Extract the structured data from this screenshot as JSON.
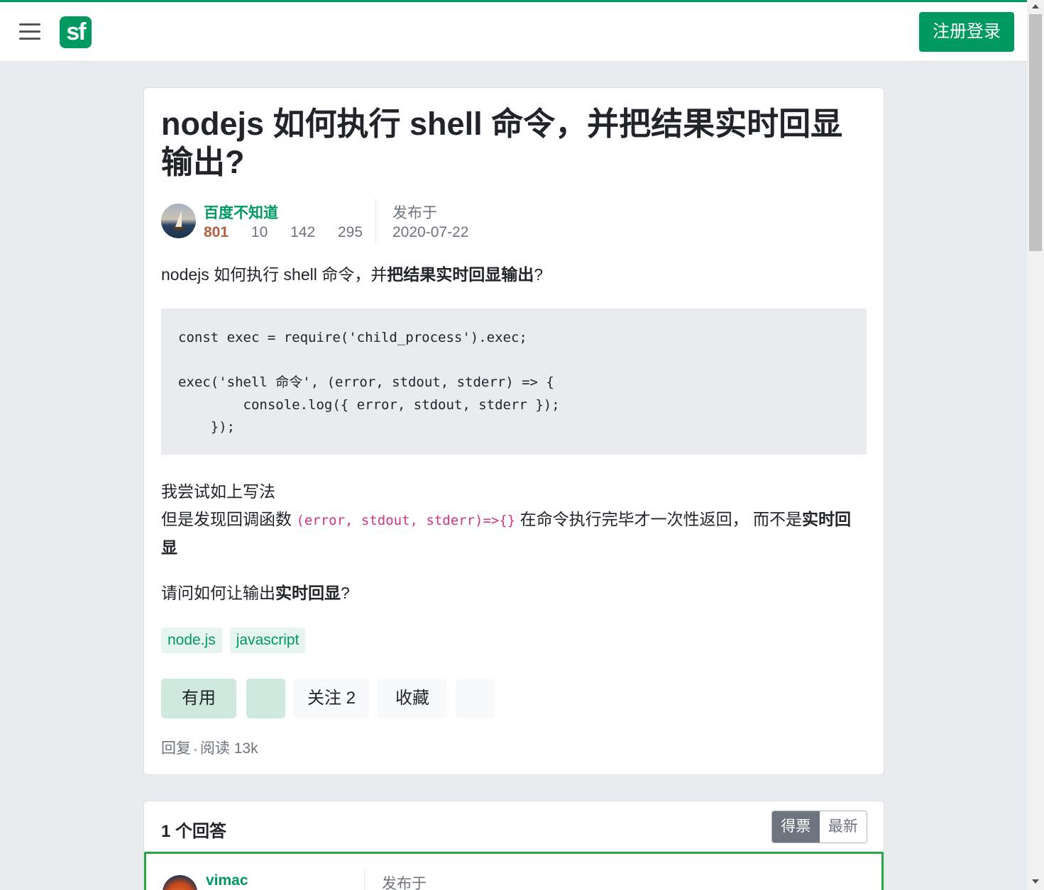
{
  "navbar": {
    "logo_text": "sf",
    "login_label": "注册登录"
  },
  "question": {
    "title": "nodejs 如何执行 shell 命令，并把结果实时回显输出?",
    "author": {
      "name": "百度不知道",
      "reputation": "801",
      "stat1": "10",
      "stat2": "142",
      "stat3": "295"
    },
    "published_label": "发布于",
    "published_date": "2020-07-22",
    "body": {
      "p1_plain": "nodejs 如何执行 shell 命令，并",
      "p1_bold": "把结果实时回显输出",
      "p1_end": "?",
      "code": "const exec = require('child_process').exec;\n\nexec('shell 命令', (error, stdout, stderr) => {\n        console.log({ error, stdout, stderr });\n    });",
      "p2_line1": "我尝试如上写法",
      "p2_line2_start": "但是发现回调函数 ",
      "p2_inline_code": "(error, stdout, stderr)=>{}",
      "p2_line2_mid": " 在命令执行完毕才一次性返回， 而不是",
      "p2_bold": "实时回显",
      "p3_plain": "请问如何让输出",
      "p3_bold": "实时回显",
      "p3_end": "?"
    },
    "tags": [
      "node.js",
      "javascript"
    ],
    "actions": {
      "useful": "有用",
      "follow": "关注 2",
      "favorite": "收藏"
    },
    "meta": {
      "reply": "回复",
      "separator": "•",
      "reads": "阅读 13k"
    }
  },
  "answers": {
    "title": "1 个回答",
    "sort_votes": "得票",
    "sort_latest": "最新",
    "first": {
      "author": "vimac",
      "published_label": "发布于"
    }
  },
  "colors": {
    "brand": "#009a61",
    "accepted_border": "#28a745",
    "reputation": "#b25f42",
    "inline_code": "#d63384"
  }
}
